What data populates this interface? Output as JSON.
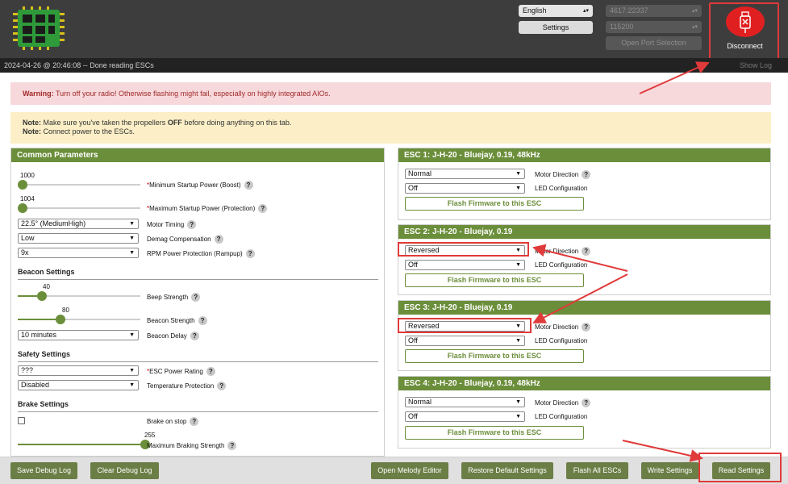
{
  "header": {
    "language": "English",
    "settings_label": "Settings",
    "port": "4617:22337",
    "baud": "115200",
    "open_port_label": "Open Port Selection",
    "disconnect_label": "Disconnect"
  },
  "log": {
    "text": "2024-04-26 @ 20:46:08 -- Done reading ESCs",
    "show_log": "Show Log"
  },
  "warning": {
    "title": "Warning:",
    "text": " Turn off your radio! Otherwise flashing might fail, especially on highly integrated AIOs."
  },
  "note": {
    "title1": "Note:",
    "text1a": " Make sure you've taken the propellers ",
    "text1b": "OFF",
    "text1c": " before doing anything on this tab.",
    "title2": "Note:",
    "text2": " Connect power to the ESCs."
  },
  "common": {
    "title": "Common Parameters",
    "min_startup": {
      "value": "1000",
      "label": "Minimum Startup Power (Boost)"
    },
    "max_startup": {
      "value": "1004",
      "label": "Maximum Startup Power (Protection)"
    },
    "motor_timing": {
      "value": "22.5° (MediumHigh)",
      "label": "Motor Timing"
    },
    "demag": {
      "value": "Low",
      "label": "Demag Compensation"
    },
    "rpm_protection": {
      "value": "9x",
      "label": "RPM Power Protection (Rampup)"
    },
    "beacon_section": "Beacon Settings",
    "beep_strength": {
      "value": "40",
      "label": "Beep Strength"
    },
    "beacon_strength": {
      "value": "80",
      "label": "Beacon Strength"
    },
    "beacon_delay": {
      "value": "10 minutes",
      "label": "Beacon Delay"
    },
    "safety_section": "Safety Settings",
    "power_rating": {
      "value": "???",
      "label": "ESC Power Rating"
    },
    "temp_protection": {
      "value": "Disabled",
      "label": "Temperature Protection"
    },
    "brake_section": "Brake Settings",
    "brake_on_stop": {
      "label": "Brake on stop"
    },
    "max_braking": {
      "value": "255",
      "label": "Maximum Braking Strength"
    },
    "help": "?",
    "req": "*"
  },
  "sliders": {
    "min_startup": 0.0,
    "max_startup": 0.0,
    "beep_strength": 0.16,
    "beacon_strength": 0.31,
    "max_braking": 1.0
  },
  "escs": [
    {
      "title": "ESC 1: J-H-20 - Bluejay, 0.19, 48kHz",
      "direction": "Normal",
      "direction_label": "Motor Direction",
      "led": "Off",
      "led_label": "LED Configuration",
      "flash": "Flash Firmware to this ESC"
    },
    {
      "title": "ESC 2: J-H-20 - Bluejay, 0.19",
      "direction": "Reversed",
      "direction_label": "Motor Direction",
      "led": "Off",
      "led_label": "LED Configuration",
      "flash": "Flash Firmware to this ESC"
    },
    {
      "title": "ESC 3: J-H-20 - Bluejay, 0.19",
      "direction": "Reversed",
      "direction_label": "Motor Direction",
      "led": "Off",
      "led_label": "LED Configuration",
      "flash": "Flash Firmware to this ESC"
    },
    {
      "title": "ESC 4: J-H-20 - Bluejay, 0.19, 48kHz",
      "direction": "Normal",
      "direction_label": "Motor Direction",
      "led": "Off",
      "led_label": "LED Configuration",
      "flash": "Flash Firmware to this ESC"
    }
  ],
  "footer": {
    "save_debug": "Save Debug Log",
    "clear_debug": "Clear Debug Log",
    "melody": "Open Melody Editor",
    "restore": "Restore Default Settings",
    "flash_all": "Flash All ESCs",
    "write": "Write Settings",
    "read": "Read Settings"
  },
  "colors": {
    "accent": "#6b8e3a",
    "annotation": "#e03a3a",
    "disconnect": "#e02020"
  },
  "icons": {
    "logo": "esc-board-logo-icon",
    "disconnect": "usb-disconnect-icon"
  }
}
